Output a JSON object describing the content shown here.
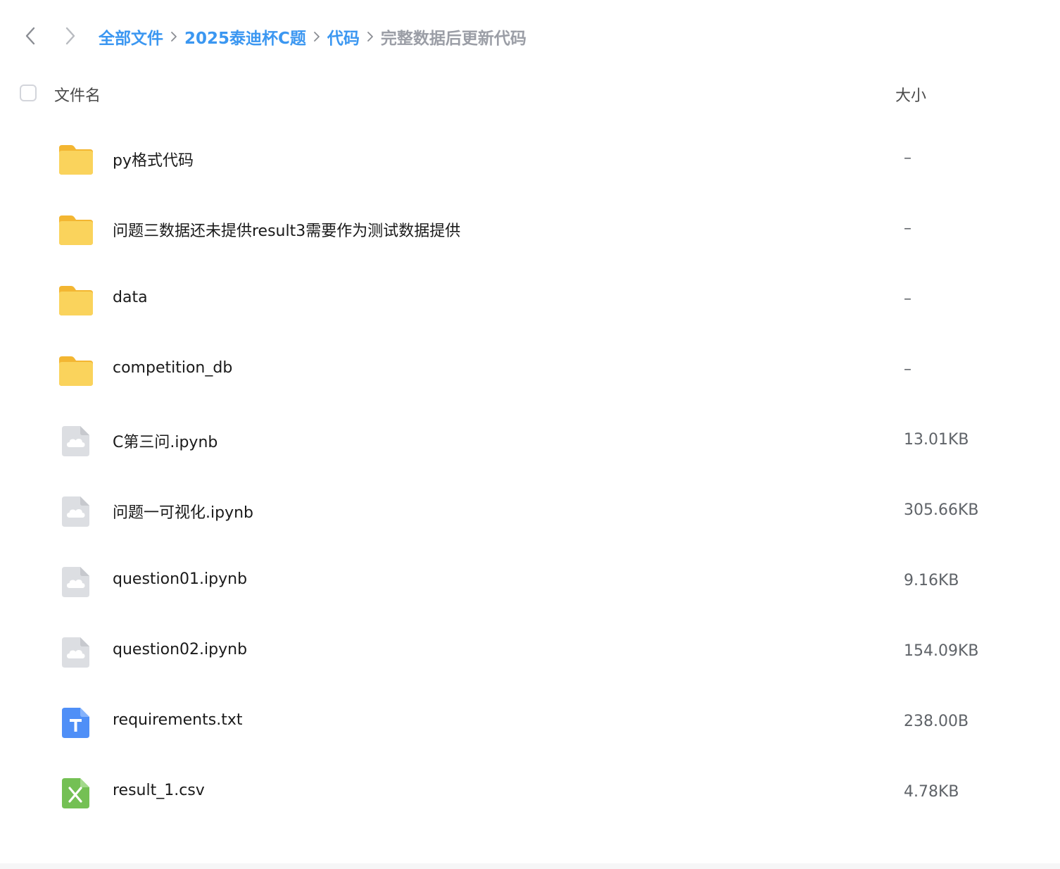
{
  "nav": {
    "back_icon": "chevron-left-icon",
    "forward_icon": "chevron-right-icon"
  },
  "breadcrumb": {
    "items": [
      {
        "label": "全部文件"
      },
      {
        "label": "2025泰迪杯C题"
      },
      {
        "label": "代码"
      },
      {
        "label": "完整数据后更新代码"
      }
    ]
  },
  "header": {
    "name_label": "文件名",
    "size_label": "大小"
  },
  "files": [
    {
      "name": "py格式代码",
      "size": "–",
      "icon": "folder-icon"
    },
    {
      "name": "问题三数据还未提供result3需要作为测试数据提供",
      "size": "–",
      "icon": "folder-icon"
    },
    {
      "name": "data",
      "size": "–",
      "icon": "folder-icon"
    },
    {
      "name": "competition_db",
      "size": "–",
      "icon": "folder-icon"
    },
    {
      "name": "C第三问.ipynb",
      "size": "13.01KB",
      "icon": "cloud-file-icon"
    },
    {
      "name": "问题一可视化.ipynb",
      "size": "305.66KB",
      "icon": "cloud-file-icon"
    },
    {
      "name": "question01.ipynb",
      "size": "9.16KB",
      "icon": "cloud-file-icon"
    },
    {
      "name": "question02.ipynb",
      "size": "154.09KB",
      "icon": "cloud-file-icon"
    },
    {
      "name": "requirements.txt",
      "size": "238.00B",
      "icon": "text-file-icon"
    },
    {
      "name": "result_1.csv",
      "size": "4.78KB",
      "icon": "spreadsheet-file-icon"
    }
  ],
  "colors": {
    "link": "#3b97f1",
    "folder": "#f8c84a",
    "text_file": "#4f8ff7",
    "sheet_file": "#7ac35a",
    "cloud_file": "#d8dade"
  }
}
